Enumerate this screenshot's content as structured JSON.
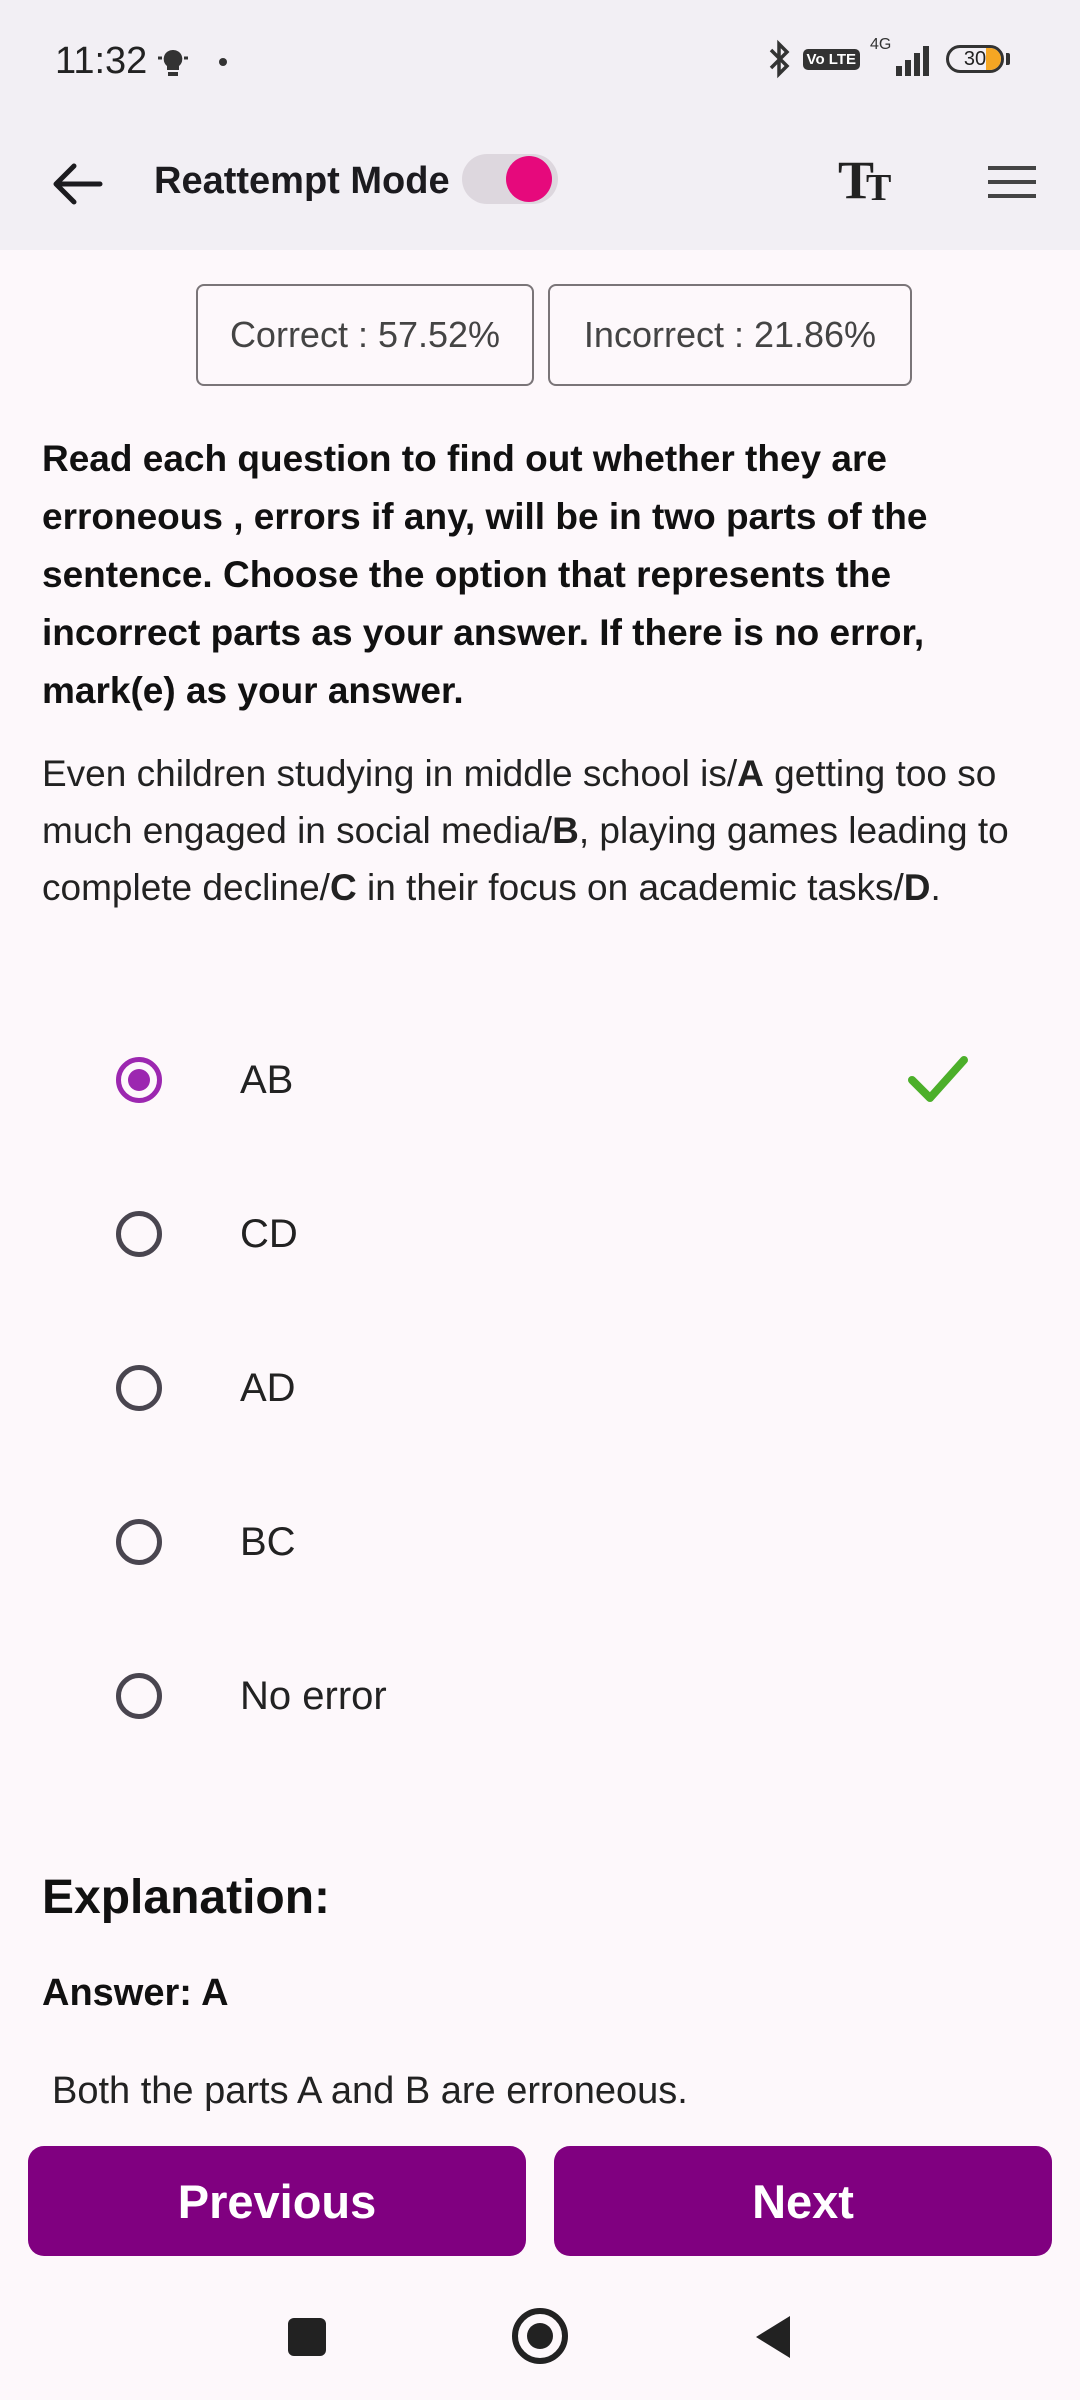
{
  "status_bar": {
    "time": "11:32",
    "volte": "Vo LTE",
    "network": "4G",
    "battery": "30"
  },
  "app_bar": {
    "title": "Reattempt Mode",
    "toggle_on": true
  },
  "stats": {
    "correct": "Correct : 57.52%",
    "incorrect": "Incorrect : 21.86%"
  },
  "instructions": "Read each question to find out whether they are erroneous , errors if any, will be in two parts of the sentence. Choose the option that represents the incorrect parts as your answer. If there is no error, mark(e) as your answer.",
  "question": {
    "segments": [
      "Even children studying in middle school is/",
      "A",
      " getting too so much engaged in social media/",
      "B",
      ", playing games leading to complete decline/",
      "C",
      " in their focus on academic tasks/",
      "D",
      "."
    ]
  },
  "options": [
    {
      "label": "AB",
      "selected": true,
      "correct": true
    },
    {
      "label": "CD",
      "selected": false,
      "correct": false
    },
    {
      "label": "AD",
      "selected": false,
      "correct": false
    },
    {
      "label": "BC",
      "selected": false,
      "correct": false
    },
    {
      "label": "No error",
      "selected": false,
      "correct": false
    }
  ],
  "explanation": {
    "title": "Explanation:",
    "answer": "Answer: A",
    "text": "Both the parts A and B are erroneous."
  },
  "buttons": {
    "previous": "Previous",
    "next": "Next"
  },
  "colors": {
    "accent": "#800080",
    "radio_selected": "#9c27b0",
    "toggle_thumb": "#e6097c",
    "check": "#4caf2a"
  }
}
